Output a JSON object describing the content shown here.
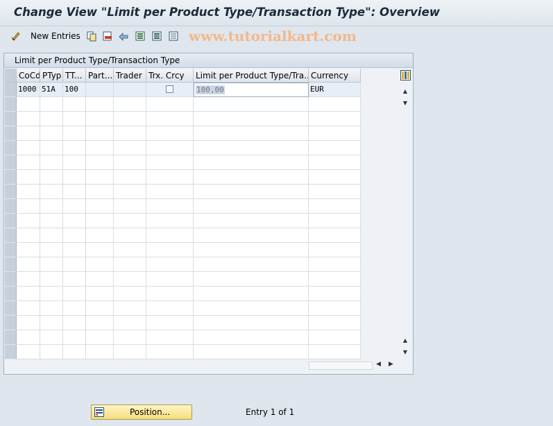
{
  "window": {
    "title": "Change View \"Limit per Product Type/Transaction Type\": Overview"
  },
  "toolbar": {
    "new_entries_label": "New Entries",
    "watermark": "www.tutorialkart.com",
    "icons": [
      "change-display-icon",
      "copy-icon",
      "delete-icon",
      "undo-icon",
      "select-all-icon",
      "select-block-icon",
      "deselect-all-icon"
    ]
  },
  "panel": {
    "title": "Limit per Product Type/Transaction Type",
    "columns": [
      {
        "label": "CoCd"
      },
      {
        "label": "PTyp"
      },
      {
        "label": "TT..."
      },
      {
        "label": "Part..."
      },
      {
        "label": "Trader"
      },
      {
        "label": "Trx. Crcy"
      },
      {
        "label": "Limit per Product Type/Tra..."
      },
      {
        "label": "Currency"
      }
    ],
    "rows": [
      {
        "cocd": "1000",
        "ptyp": "51A",
        "tt": "100",
        "part": "",
        "trader": "",
        "trx_crcy_checked": false,
        "limit": "100,00",
        "currency": "EUR"
      }
    ],
    "empty_rows": 18
  },
  "footer": {
    "position_button_label": "Position...",
    "entry_text": "Entry 1 of 1"
  },
  "colors": {
    "background": "#dfe6ed",
    "button_yellow": "#f5dc7a",
    "watermark": "#f2b98a"
  }
}
